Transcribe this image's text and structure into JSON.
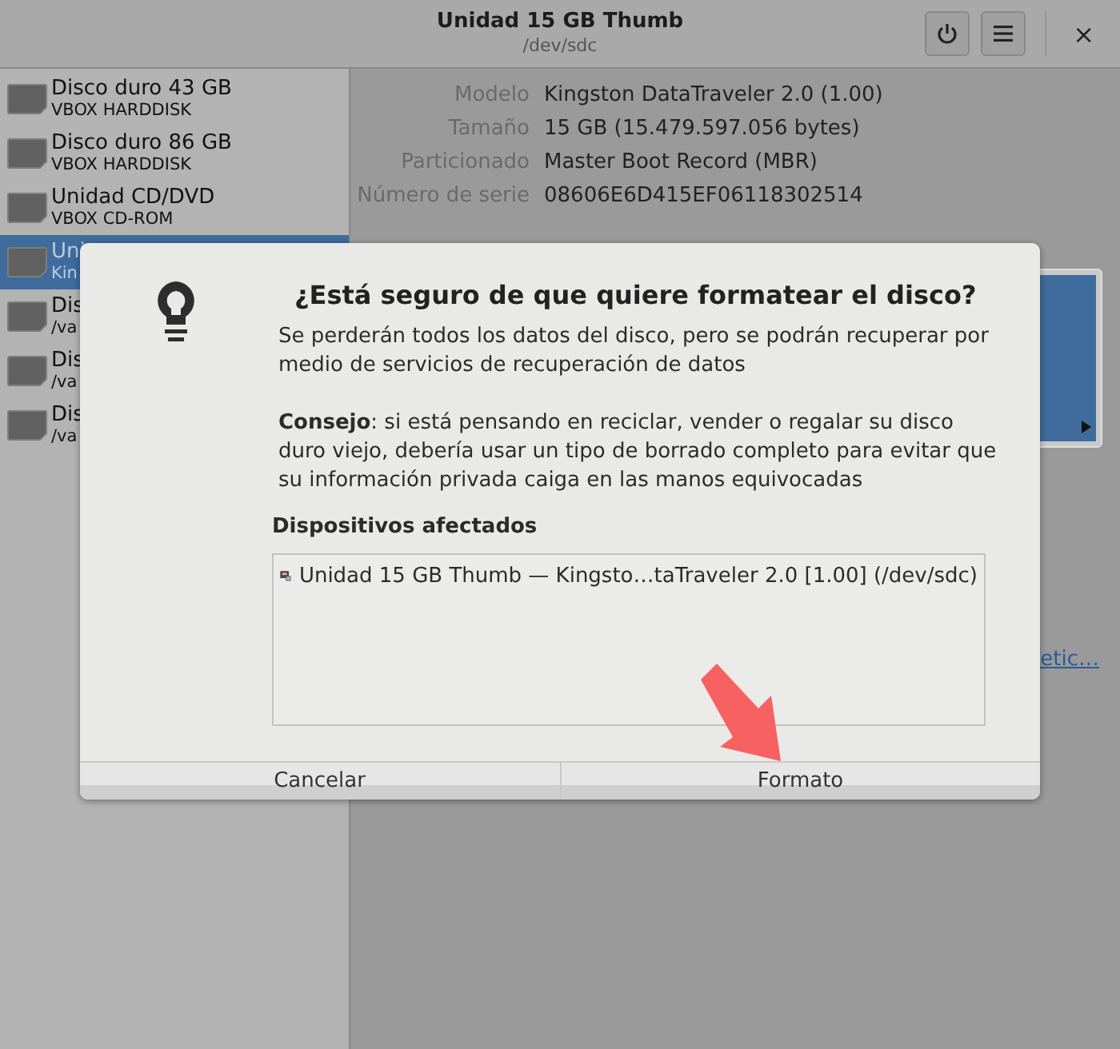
{
  "window": {
    "title": "Unidad 15 GB Thumb",
    "subtitle": "/dev/sdc",
    "buttons": [
      {
        "kind": "power"
      },
      {
        "kind": "menu"
      }
    ],
    "close": "×"
  },
  "sidebar": {
    "items": [
      {
        "name": "Disco duro 43 GB",
        "detail": "VBOX HARDDISK",
        "selected": false
      },
      {
        "name": "Disco duro 86 GB",
        "detail": "VBOX HARDDISK",
        "selected": false
      },
      {
        "name": "Unidad CD/DVD",
        "detail": "VBOX CD-ROM",
        "selected": false
      },
      {
        "name": "Uni",
        "detail": "Kin",
        "selected": true
      },
      {
        "name": "Dis",
        "detail": "/va",
        "selected": false
      },
      {
        "name": "Dis",
        "detail": "/va",
        "selected": false
      },
      {
        "name": "Dis",
        "detail": "/va",
        "selected": false
      }
    ]
  },
  "details": [
    {
      "label": "Modelo",
      "value": "Kingston DataTraveler 2.0 (1.00)"
    },
    {
      "label": "Tamaño",
      "value": "15 GB (15.479.597.056 bytes)"
    },
    {
      "label": "Particionado",
      "value": "Master Boot Record (MBR)"
    },
    {
      "label": "Número de serie",
      "value": "08606E6D415EF06118302514"
    }
  ],
  "link": "etic…",
  "dialog": {
    "title": "¿Está seguro de que quiere formatear el disco?",
    "message": "Se perderán todos los datos del disco, pero se podrán recuperar por medio de servicios de recuperación de datos",
    "advice": "**Consejo**: si está pensando en reciclar, vender o regalar su disco duro viejo, debería usar un tipo de borrado completo para evitar que su información privada caiga en las manos equivocadas",
    "section": "Dispositivos afectados",
    "devices": [
      "Unidad 15 GB Thumb — Kingsto…taTraveler 2.0 [1.00] (/dev/sdc)"
    ],
    "buttons": [
      {
        "label": "Cancelar"
      },
      {
        "label": "Formato"
      }
    ]
  },
  "annotation": {
    "kind": "arrow"
  }
}
